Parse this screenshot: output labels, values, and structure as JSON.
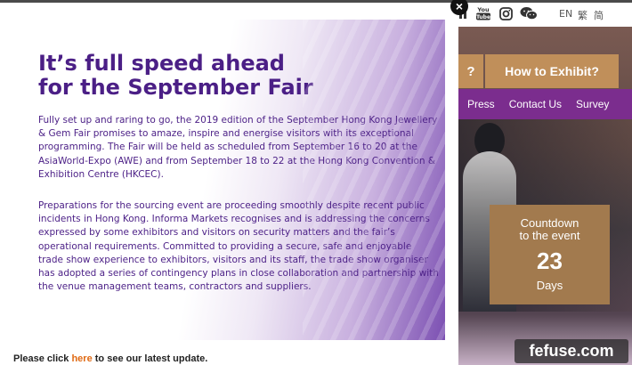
{
  "background": {
    "social": {
      "partial_icon": "linkedin-icon",
      "youtube_label": "You Tube",
      "instagram_icon": "instagram-icon",
      "wechat_icon": "wechat-icon"
    },
    "languages": [
      "EN",
      "繁",
      "简"
    ],
    "buttons": {
      "partial_label": "?",
      "exhibit_label": "How to Exhibit?"
    },
    "nav": [
      "Press",
      "Contact Us",
      "Survey"
    ],
    "countdown": {
      "label_line1": "Countdown",
      "label_line2": "to the event",
      "number": "23",
      "unit": "Days"
    },
    "watermark": "fefuse.com"
  },
  "modal": {
    "title_line1": "It’s full speed ahead",
    "title_line2": "for the September Fair",
    "paragraph1": "Fully set up and raring to go, the 2019 edition of the September Hong Kong Jewellery & Gem Fair promises to amaze, inspire and energise visitors with its exceptional programming. The Fair will be held as scheduled from September 16 to 20 at the AsiaWorld-Expo (AWE) and from September 18 to 22 at the Hong Kong Convention & Exhibition Centre (HKCEC).",
    "paragraph2": "Preparations for the sourcing event are proceeding smoothly despite recent public incidents in Hong Kong. Informa Markets recognises and is addressing the concerns expressed by some exhibitors and visitors on security matters and the fair’s operational requirements. Committed to providing a secure, safe and enjoyable trade show experience to exhibitors, visitors and its staff, the trade show organiser has adopted a series of contingency plans in close collaboration and partnership with the venue management teams, contractors and suppliers.",
    "update_prefix": "Please click",
    "update_link": "here",
    "update_suffix": "to see our latest update.",
    "close_symbol": "×"
  },
  "colors": {
    "title_purple": "#4b1f86",
    "nav_purple": "#7b2d8e",
    "gold": "#c08f5a",
    "link_orange": "#e06a14"
  }
}
